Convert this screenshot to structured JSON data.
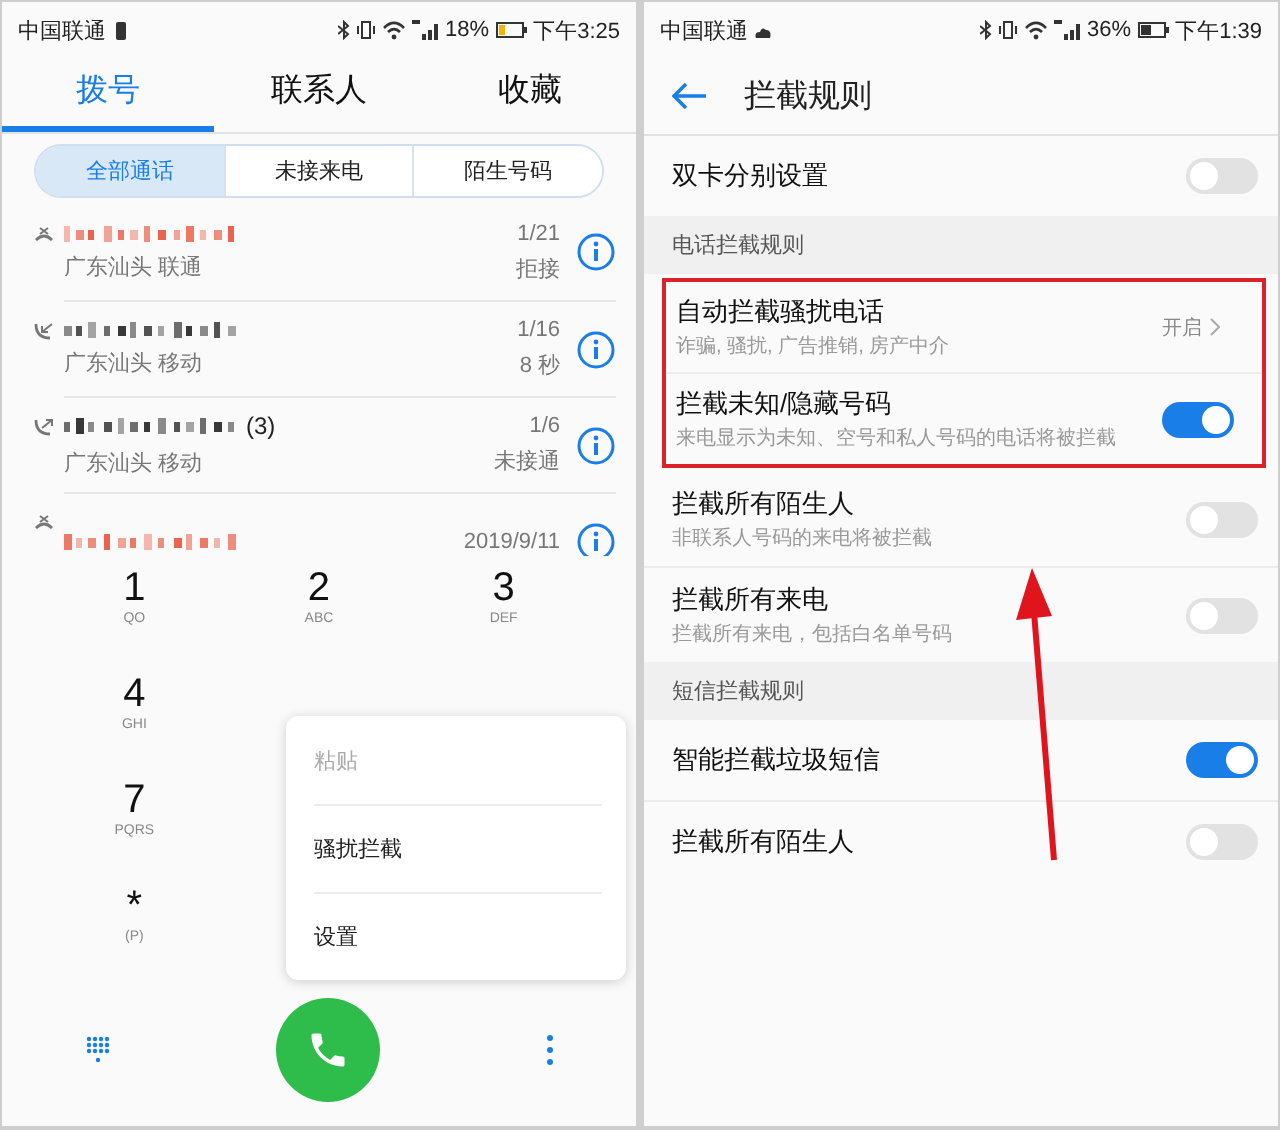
{
  "left": {
    "status_bar": {
      "carrier": "中国联通",
      "battery_percent": "18%",
      "time": "下午3:25"
    },
    "tabs": [
      {
        "label": "拨号",
        "selected": true
      },
      {
        "label": "联系人",
        "selected": false
      },
      {
        "label": "收藏",
        "selected": false
      }
    ],
    "filters": [
      {
        "label": "全部通话",
        "selected": true
      },
      {
        "label": "未接来电",
        "selected": false
      },
      {
        "label": "陌生号码",
        "selected": false
      }
    ],
    "calls": [
      {
        "kind": "rejected",
        "highlight": true,
        "location": "广东汕头 联通",
        "date": "1/21",
        "status": "拒接"
      },
      {
        "kind": "incoming",
        "highlight": false,
        "location": "广东汕头 移动",
        "date": "1/16",
        "status": "8 秒"
      },
      {
        "kind": "outgoing",
        "highlight": false,
        "count": "(3)",
        "location": "广东汕头 移动",
        "date": "1/6",
        "status": "未接通"
      },
      {
        "kind": "rejected",
        "highlight": true,
        "date": "2019/9/11"
      }
    ],
    "dialpad_rows": [
      [
        {
          "digit": "1",
          "letters": "QO"
        },
        {
          "digit": "2",
          "letters": "ABC"
        },
        {
          "digit": "3",
          "letters": "DEF"
        }
      ],
      [
        {
          "digit": "4",
          "letters": "GHI"
        }
      ],
      [
        {
          "digit": "7",
          "letters": "PQRS"
        }
      ],
      [
        {
          "digit": "*",
          "letters": "(P)"
        }
      ]
    ],
    "menu": [
      {
        "label": "粘贴",
        "disabled": true
      },
      {
        "label": "骚扰拦截",
        "disabled": false
      },
      {
        "label": "设置",
        "disabled": false
      }
    ]
  },
  "right": {
    "status_bar": {
      "carrier": "中国联通",
      "battery_percent": "36%",
      "time": "下午1:39"
    },
    "title": "拦截规则",
    "sections": [
      {
        "items": [
          {
            "kind": "toggle",
            "title": "双卡分别设置",
            "on": false,
            "highlighted": false
          }
        ]
      },
      {
        "header": "电话拦截规则",
        "items": [
          {
            "kind": "link",
            "title": "自动拦截骚扰电话",
            "subtitle": "诈骗, 骚扰, 广告推销, 房产中介",
            "value": "开启",
            "highlighted": true
          },
          {
            "kind": "toggle",
            "title": "拦截未知/隐藏号码",
            "subtitle": "来电显示为未知、空号和私人号码的电话将被拦截",
            "on": true,
            "highlighted": true
          },
          {
            "kind": "toggle",
            "title": "拦截所有陌生人",
            "subtitle": "非联系人号码的来电将被拦截",
            "on": false,
            "highlighted": false
          },
          {
            "kind": "toggle",
            "title": "拦截所有来电",
            "subtitle": "拦截所有来电，包括白名单号码",
            "on": false,
            "highlighted": false
          }
        ]
      },
      {
        "header": "短信拦截规则",
        "items": [
          {
            "kind": "toggle",
            "title": "智能拦截垃圾短信",
            "on": true,
            "highlighted": false
          },
          {
            "kind": "toggle",
            "title": "拦截所有陌生人",
            "on": false,
            "highlighted": false
          }
        ]
      }
    ],
    "annotation": {
      "kind": "arrow"
    }
  }
}
